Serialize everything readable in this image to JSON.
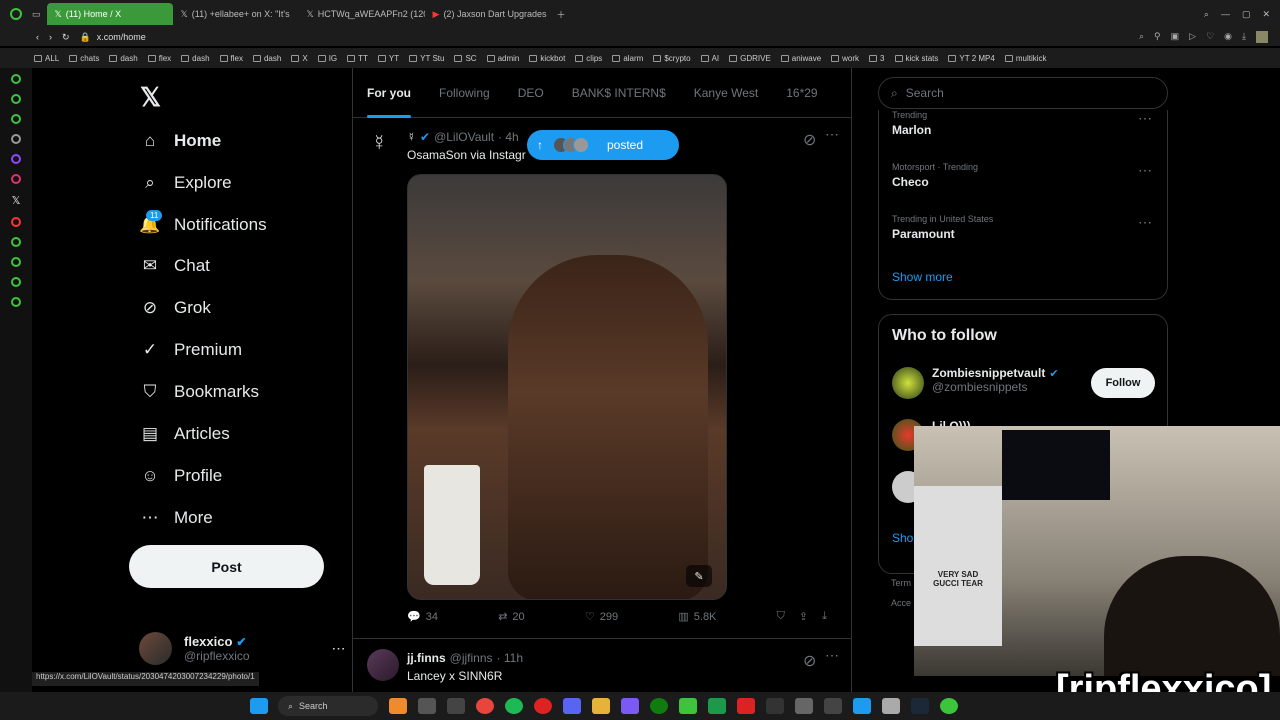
{
  "browser": {
    "tabs": [
      {
        "label": "(11) Home / X",
        "active": true
      },
      {
        "label": "(11) +ellabee+ on X: \"It's",
        "active": false
      },
      {
        "label": "HCTWq_aWEAAPFn2 (1200",
        "active": false
      },
      {
        "label": "(2) Jaxson Dart Upgrades",
        "active": false
      }
    ],
    "url": "x.com/home",
    "bookmarks": [
      "ALL",
      "chats",
      "dash",
      "flex",
      "dash",
      "flex",
      "dash",
      "X",
      "IG",
      "TT",
      "YT",
      "YT Stu",
      "SC",
      "admin",
      "kickbot",
      "clips",
      "alarm",
      "$crypto",
      "AI",
      "GDRIVE",
      "aniwave",
      "work",
      "3",
      "kick stats",
      "YT 2 MP4",
      "multikick"
    ],
    "status_url": "https://x.com/LilOVault/status/2030474203007234229/photo/1"
  },
  "nav": {
    "items": [
      {
        "label": "Home",
        "icon": "home-icon",
        "glyph": "⌂"
      },
      {
        "label": "Explore",
        "icon": "search-icon",
        "glyph": "⌕"
      },
      {
        "label": "Notifications",
        "icon": "bell-icon",
        "glyph": "🔔"
      },
      {
        "label": "Chat",
        "icon": "mail-icon",
        "glyph": "✉"
      },
      {
        "label": "Grok",
        "icon": "grok-icon",
        "glyph": "⊘"
      },
      {
        "label": "Premium",
        "icon": "verified-icon",
        "glyph": "✓"
      },
      {
        "label": "Bookmarks",
        "icon": "bookmark-icon",
        "glyph": "⛉"
      },
      {
        "label": "Articles",
        "icon": "article-icon",
        "glyph": "▤"
      },
      {
        "label": "Profile",
        "icon": "person-icon",
        "glyph": "☺"
      },
      {
        "label": "More",
        "icon": "more-circle-icon",
        "glyph": "⋯"
      }
    ],
    "notification_count": "11",
    "post_label": "Post",
    "account": {
      "name": "flexxico",
      "handle": "@ripflexxico"
    }
  },
  "timeline": {
    "tabs": [
      "For you",
      "Following",
      "DEO",
      "BANK$ INTERN$",
      "Kanye West",
      "16*29"
    ],
    "new_posts_label": "posted",
    "tweet1": {
      "author_symbol": "☿",
      "handle": "@LilOVault",
      "time": "· 4h",
      "text": "OsamaSon via Instagr",
      "replies": "34",
      "reposts": "20",
      "likes": "299",
      "views": "5.8K"
    },
    "tweet2": {
      "name": "jj.finns",
      "handle": "@jjfinns",
      "time": "· 11h",
      "text": "Lancey x SINN6R"
    }
  },
  "right": {
    "search_placeholder": "Search",
    "trends": [
      {
        "context": "Trending",
        "name": "Marlon"
      },
      {
        "context": "Motorsport · Trending",
        "name": "Checo"
      },
      {
        "context": "Trending in United States",
        "name": "Paramount"
      }
    ],
    "show_more": "Show more",
    "who_to_follow": "Who to follow",
    "suggestion": {
      "name": "Zombiesnippetvault",
      "handle": "@zombiesnippets",
      "follow_label": "Follow"
    },
    "suggestion2_partial": "Lil O)))",
    "show_partial": "Sho",
    "terms_partial": "Term",
    "access_partial": "Acce"
  },
  "overlay": {
    "streamer_tag": "[ripflexxico]",
    "shirt_text": "VERY SAD GUCCI TEAR"
  },
  "taskbar": {
    "search_label": "Search"
  }
}
